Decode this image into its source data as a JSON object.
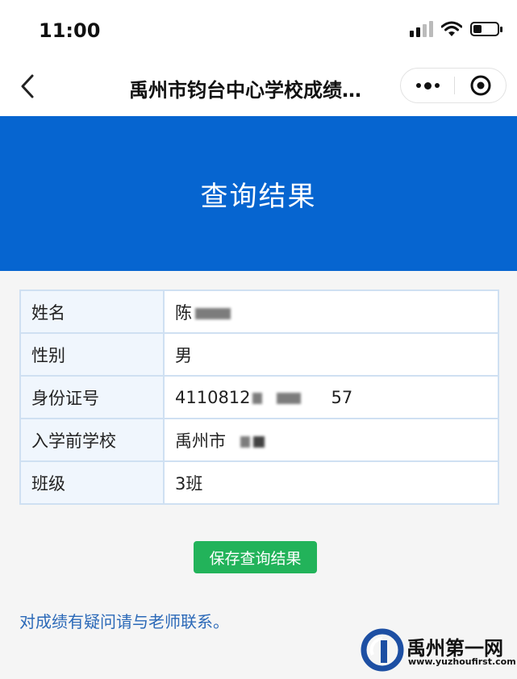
{
  "status_bar": {
    "time": "11:00",
    "battery_level": 0.35
  },
  "nav": {
    "title": "禹州市钧台中心学校成绩…"
  },
  "banner": {
    "title": "查询结果"
  },
  "results": [
    {
      "label": "姓名",
      "value": "陈"
    },
    {
      "label": "性别",
      "value": "男"
    },
    {
      "label": "身份证号",
      "value": "4110812",
      "value_tail": "57"
    },
    {
      "label": "入学前学校",
      "value": "禹州市"
    },
    {
      "label": "班级",
      "value": "3班"
    }
  ],
  "actions": {
    "save_label": "保存查询结果"
  },
  "footer": {
    "note": "对成绩有疑问请与老师联系。"
  },
  "watermark": {
    "name": "禹州第一网",
    "url": "www.yuzhoufirst.com"
  },
  "colors": {
    "banner": "#0665d0",
    "save_button": "#22b35a",
    "note_text": "#2b69b8",
    "table_border": "#cfe0f2"
  }
}
